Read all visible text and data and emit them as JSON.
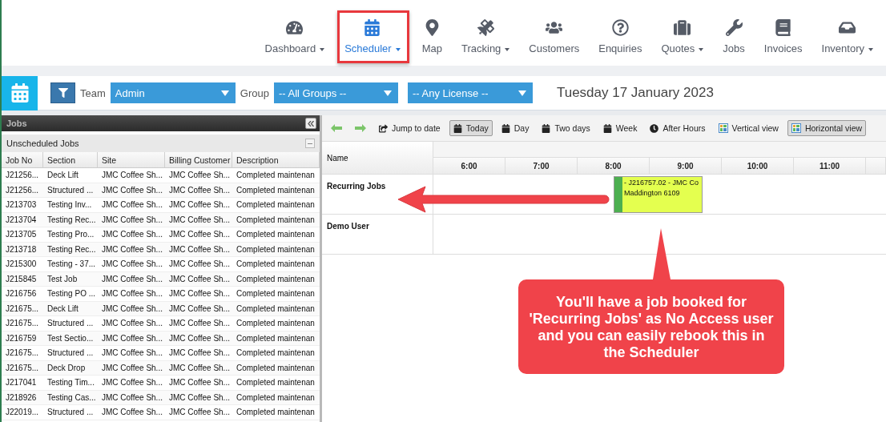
{
  "nav": [
    {
      "label": "Dashboard",
      "dropdown": true,
      "selected": false
    },
    {
      "label": "Scheduler",
      "dropdown": true,
      "selected": true
    },
    {
      "label": "Map",
      "dropdown": false,
      "selected": false
    },
    {
      "label": "Tracking",
      "dropdown": true,
      "selected": false
    },
    {
      "label": "Customers",
      "dropdown": false,
      "selected": false
    },
    {
      "label": "Enquiries",
      "dropdown": false,
      "selected": false
    },
    {
      "label": "Quotes",
      "dropdown": true,
      "selected": false
    },
    {
      "label": "Jobs",
      "dropdown": false,
      "selected": false
    },
    {
      "label": "Invoices",
      "dropdown": false,
      "selected": false
    },
    {
      "label": "Inventory",
      "dropdown": true,
      "selected": false
    }
  ],
  "filters": {
    "team_label": "Team",
    "team": "Admin",
    "group_label": "Group",
    "group": "-- All Groups --",
    "license": "-- Any License --",
    "date": "Tuesday 17 January 2023"
  },
  "jobs_panel": {
    "title": "Jobs",
    "section": "Unscheduled Jobs",
    "columns": [
      "Job No",
      "Section",
      "Site",
      "Billing Customer",
      "Description"
    ],
    "rows": [
      [
        "J21256...",
        "Deck Lift",
        "JMC Coffee Sh...",
        "JMC Coffee Sh...",
        "Completed maintenan"
      ],
      [
        "J21256...",
        "Structured ...",
        "JMC Coffee Sh...",
        "JMC Coffee Sh...",
        "Completed maintenan"
      ],
      [
        "J213703",
        "Testing Inv...",
        "JMC Coffee Sh...",
        "JMC Coffee Sh...",
        "Completed maintenan"
      ],
      [
        "J213704",
        "Testing Rec...",
        "JMC Coffee Sh...",
        "JMC Coffee Sh...",
        "Completed maintenan"
      ],
      [
        "J213705",
        "Testing Pro...",
        "JMC Coffee Sh...",
        "JMC Coffee Sh...",
        "Completed maintenan"
      ],
      [
        "J213718",
        "Testing Rec...",
        "JMC Coffee Sh...",
        "JMC Coffee Sh...",
        "Completed maintenan"
      ],
      [
        "J215300",
        "Testing - 37...",
        "JMC Coffee Sh...",
        "JMC Coffee Sh...",
        "Completed maintenan"
      ],
      [
        "J215845",
        "Test Job",
        "JMC Coffee Sh...",
        "JMC Coffee Sh...",
        "Completed maintenan"
      ],
      [
        "J216756",
        "Testing PO ...",
        "JMC Coffee Sh...",
        "JMC Coffee Sh...",
        "Completed maintenan"
      ],
      [
        "J21675...",
        "Deck Lift",
        "JMC Coffee Sh...",
        "JMC Coffee Sh...",
        "Completed maintenan"
      ],
      [
        "J21675...",
        "Structured ...",
        "JMC Coffee Sh...",
        "JMC Coffee Sh...",
        "Completed maintenan"
      ],
      [
        "J216759",
        "Test Sectio...",
        "JMC Coffee Sh...",
        "JMC Coffee Sh...",
        "Completed maintenan"
      ],
      [
        "J21675...",
        "Structured ...",
        "JMC Coffee Sh...",
        "JMC Coffee Sh...",
        "Completed maintenan"
      ],
      [
        "J21675...",
        "Deck Drop",
        "JMC Coffee Sh...",
        "JMC Coffee Sh...",
        "Completed maintenan"
      ],
      [
        "J217041",
        "Testing Tim...",
        "JMC Coffee Sh...",
        "JMC Coffee Sh...",
        "Completed maintenan"
      ],
      [
        "J218926",
        "Testing Cas...",
        "JMC Coffee Sh...",
        "JMC Coffee Sh...",
        "Completed maintenan"
      ],
      [
        "J22019...",
        "Structured ...",
        "JMC Coffee Sh...",
        "JMC Coffee Sh...",
        "Completed maintenan"
      ]
    ]
  },
  "scheduler": {
    "toolbar": [
      {
        "kind": "prev",
        "selected": false
      },
      {
        "kind": "next",
        "selected": false
      },
      {
        "kind": "jump",
        "label": "Jump to date",
        "selected": false
      },
      {
        "kind": "calendar",
        "label": "Today",
        "selected": true
      },
      {
        "kind": "calendar",
        "label": "Day",
        "selected": false
      },
      {
        "kind": "calendar",
        "label": "Two days",
        "selected": false
      },
      {
        "kind": "calendar",
        "label": "Week",
        "selected": false
      },
      {
        "kind": "clock",
        "label": "After Hours",
        "selected": false
      },
      {
        "kind": "layout",
        "label": "Vertical view",
        "selected": false
      },
      {
        "kind": "layout",
        "label": "Horizontal view",
        "selected": true
      }
    ],
    "name_header": "Name",
    "hours": [
      "6:00",
      "7:00",
      "8:00",
      "9:00",
      "10:00",
      "11:00"
    ],
    "resources": [
      {
        "name": "Recurring Jobs",
        "bookings": [
          {
            "text": "- J216757.02 - JMC Co",
            "line2": "Maddington 6109",
            "color": "#e4ff4f"
          }
        ]
      },
      {
        "name": "Demo User"
      }
    ]
  },
  "callout": "You'll have a job booked for 'Recurring Jobs' as No Access user and you can easily rebook this in the Scheduler"
}
